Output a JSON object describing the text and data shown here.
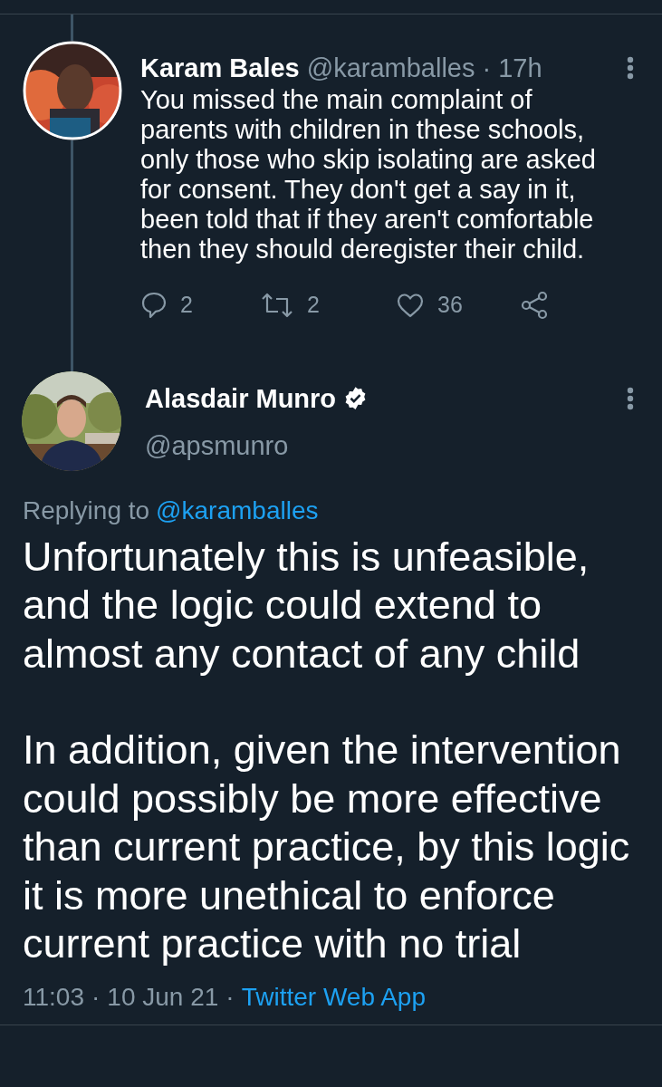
{
  "parent_tweet": {
    "name": "Karam Bales",
    "handle": "@karamballes",
    "separator": "·",
    "time": "17h",
    "text": "You missed the main complaint of parents with children in these schools, only those who skip isolating are asked for consent. They don't get a say in it, been told that if they aren't comfortable then they should deregister their child.",
    "actions": [
      {
        "kind": "reply",
        "count": "2"
      },
      {
        "kind": "retweet",
        "count": "2"
      },
      {
        "kind": "like",
        "count": "36"
      },
      {
        "kind": "share"
      }
    ]
  },
  "main_tweet": {
    "name": "Alasdair Munro",
    "verified": true,
    "handle": "@apsmunro",
    "replying_label": "Replying to",
    "replying_to": "@karamballes",
    "paragraphs": [
      "Unfortunately this is unfeasible, and the logic could extend to almost any contact of any child",
      "In addition, given the intervention could possibly be more effective than current practice, by this logic it is more unethical to enforce current practice with no trial"
    ],
    "time": "11:03",
    "separator_1": "·",
    "date": "10 Jun 21",
    "separator_2": "·",
    "source": "Twitter Web App"
  }
}
